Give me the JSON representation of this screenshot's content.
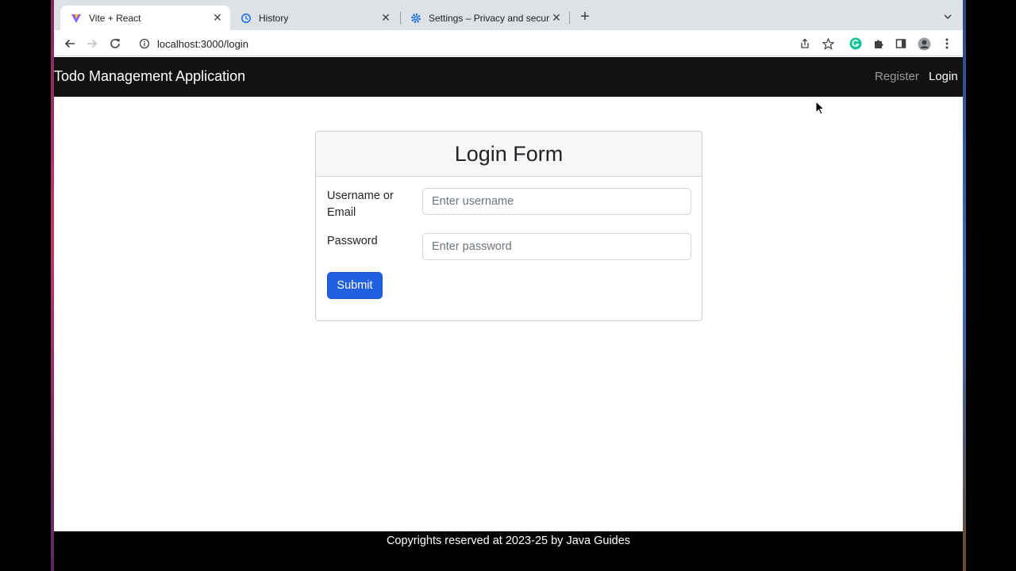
{
  "browser": {
    "tabs": [
      {
        "title": "Vite + React",
        "active": true,
        "icon": "vite-icon"
      },
      {
        "title": "History",
        "active": false,
        "icon": "history-icon"
      },
      {
        "title": "Settings – Privacy and security",
        "active": false,
        "icon": "gear-icon"
      }
    ],
    "url": "localhost:3000/login"
  },
  "navbar": {
    "brand": "Todo Management Application",
    "links": [
      {
        "label": "Register",
        "active": false
      },
      {
        "label": "Login",
        "active": true
      }
    ]
  },
  "login_form": {
    "title": "Login Form",
    "username_label": "Username or Email",
    "username_placeholder": "Enter username",
    "username_value": "",
    "password_label": "Password",
    "password_placeholder": "Enter password",
    "password_value": "",
    "submit_label": "Submit"
  },
  "footer": {
    "text": "Copyrights reserved at 2023-25 by Java Guides"
  },
  "colors": {
    "navbar_bg": "#121212",
    "primary_button": "#1f5fe0",
    "footer_bg": "#000000"
  }
}
